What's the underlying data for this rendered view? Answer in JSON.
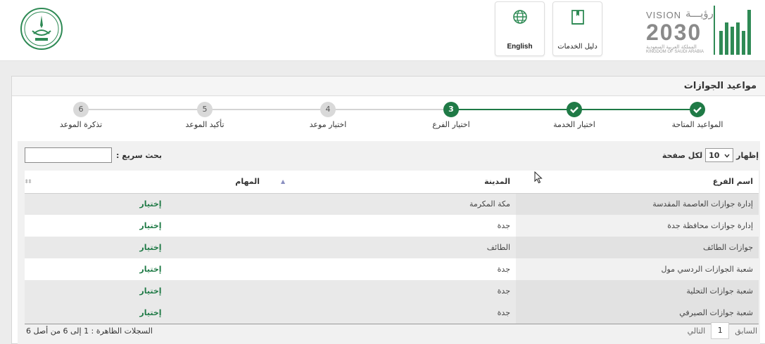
{
  "header": {
    "vision": {
      "title": "VISION",
      "title_ar": "رؤيـــة",
      "year": "2030",
      "kingdom_ar": "المملكة العربية السعودية",
      "kingdom_en": "KINGDOM OF SAUDI ARABIA"
    },
    "guide_button": {
      "label": "دليل الخدمات",
      "icon": "book-icon"
    },
    "english_button": {
      "label": "English",
      "icon": "globe-icon"
    }
  },
  "panel": {
    "title": "مواعيد الجوازات"
  },
  "steps": [
    {
      "number": "1",
      "label": "المواعيد المتاحة",
      "state": "done"
    },
    {
      "number": "2",
      "label": "اختيار الخدمة",
      "state": "done"
    },
    {
      "number": "3",
      "label": "اختيار الفرع",
      "state": "current"
    },
    {
      "number": "4",
      "label": "اختيار موعد",
      "state": "todo"
    },
    {
      "number": "5",
      "label": "تأكيد الموعد",
      "state": "todo"
    },
    {
      "number": "6",
      "label": "تذكرة الموعد",
      "state": "todo"
    }
  ],
  "table_controls": {
    "show_prefix": "إظهار",
    "page_size": "10",
    "show_suffix": "لكل صفحة",
    "search_label": "بحث سريع :",
    "search_value": ""
  },
  "table": {
    "headers": {
      "name": "اسم الفرع",
      "city": "المدينة",
      "tasks": "المهام"
    },
    "rows": [
      {
        "name": "إدارة جوازات العاصمة المقدسة",
        "city": "مكة المكرمة",
        "action": "إختيار"
      },
      {
        "name": "إدارة جوازات محافظة جدة",
        "city": "جدة",
        "action": "إختيار"
      },
      {
        "name": "جوازات الطائف",
        "city": "الطائف",
        "action": "إختيار"
      },
      {
        "name": "شعبة الجوازات الردسي مول",
        "city": "جدة",
        "action": "إختيار"
      },
      {
        "name": "شعبة جوازات التحلية",
        "city": "جدة",
        "action": "إختيار"
      },
      {
        "name": "شعبة جوازات الصيرفي",
        "city": "جدة",
        "action": "إختيار"
      }
    ]
  },
  "pagination": {
    "prev": "السابق",
    "page": "1",
    "next": "التالي"
  },
  "records_info": "السجلات الظاهرة : 1 إلى 6 من أصل 6",
  "colors": {
    "accent": "#1f7a46",
    "brand_green": "#2f8a55"
  }
}
